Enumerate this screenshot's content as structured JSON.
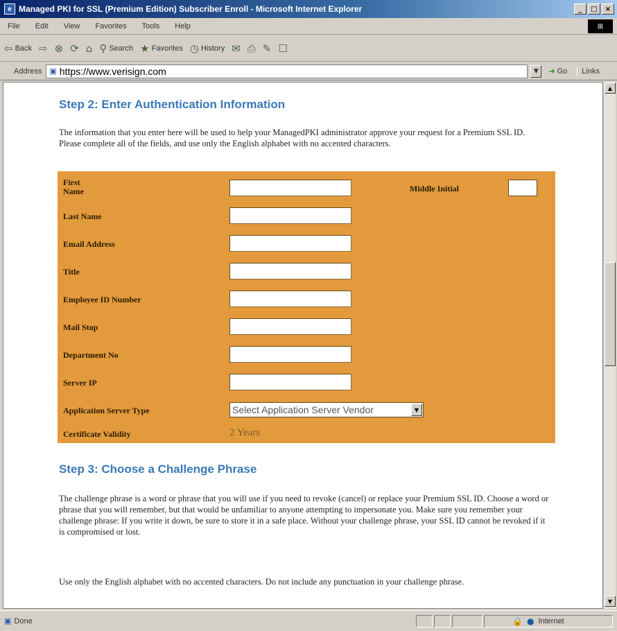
{
  "window": {
    "title": "Managed PKI for SSL (Premium Edition) Subscriber Enroll - Microsoft Internet Explorer",
    "buttons": {
      "minimize": "_",
      "maximize": "□",
      "close": "×"
    }
  },
  "menubar": {
    "items": [
      "File",
      "Edit",
      "View",
      "Favorites",
      "Tools",
      "Help"
    ]
  },
  "toolbar": {
    "back": "Back",
    "search": "Search",
    "favorites": "Favorites",
    "history": "History"
  },
  "address": {
    "label": "Address",
    "url": "https://www.verisign.com",
    "go": "Go",
    "links": "Links"
  },
  "step2": {
    "heading": "Step 2: Enter Authentication Information",
    "intro": "The information that you enter here will be used to help your ManagedPKI administrator approve your request for a Premium SSL ID. Please complete all of the fields, and use only the English alphabet with no accented characters."
  },
  "form": {
    "fields": [
      {
        "label": "First Name",
        "value": ""
      },
      {
        "label": "Last Name",
        "value": ""
      },
      {
        "label": "Email Address",
        "value": ""
      },
      {
        "label": "Title",
        "value": ""
      },
      {
        "label": "Employee ID Number",
        "value": ""
      },
      {
        "label": "Mail Stop",
        "value": ""
      },
      {
        "label": "Department No",
        "value": ""
      },
      {
        "label": "Server IP",
        "value": ""
      }
    ],
    "middle_initial_label": "Middle Initial",
    "middle_initial_value": "",
    "server_type_label": "Application Server Type",
    "server_type_selected": "Select Application Server Vendor",
    "validity_label": "Certificate Validity",
    "validity_value": "2 Years"
  },
  "step3": {
    "heading": "Step 3: Choose a Challenge Phrase",
    "para1": "The challenge phrase is a word or phrase that you will use if you need to revoke (cancel) or replace your Premium SSL ID. Choose a word or phrase that you will remember, but that would be unfamiliar to anyone attempting to impersonate you. Make sure you remember your challenge phrase: If you write it down, be sure to store it in a safe place. Without your challenge phrase, your SSL ID cannot be revoked if it is compromised or lost.",
    "para2": "Use only the English alphabet with no accented characters. Do not include any punctuation in your challenge phrase."
  },
  "statusbar": {
    "status": "Done",
    "zone": "Internet"
  },
  "colors": {
    "panel": "#e29a3c",
    "heading": "#3a78b8",
    "title_bar": "#0a246a"
  }
}
